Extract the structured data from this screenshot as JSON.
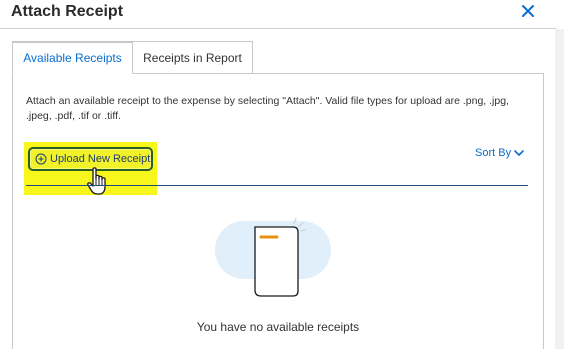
{
  "dialog": {
    "title": "Attach Receipt",
    "close_icon": "close-icon"
  },
  "tabs": [
    {
      "label": "Available Receipts",
      "active": true
    },
    {
      "label": "Receipts in Report",
      "active": false
    }
  ],
  "panel": {
    "instructions": "Attach an available receipt to the expense by selecting \"Attach\". Valid file types for upload are .png, .jpg, .jpeg, .pdf, .tif or .tiff.",
    "upload_label": "Upload New Receipt",
    "sort_label": "Sort By",
    "empty_message": "You have no available receipts"
  },
  "colors": {
    "accent": "#0a6ed1",
    "highlight": "#f7f71c",
    "divider": "#1e4e79",
    "receipt_mark": "#e8910f"
  }
}
